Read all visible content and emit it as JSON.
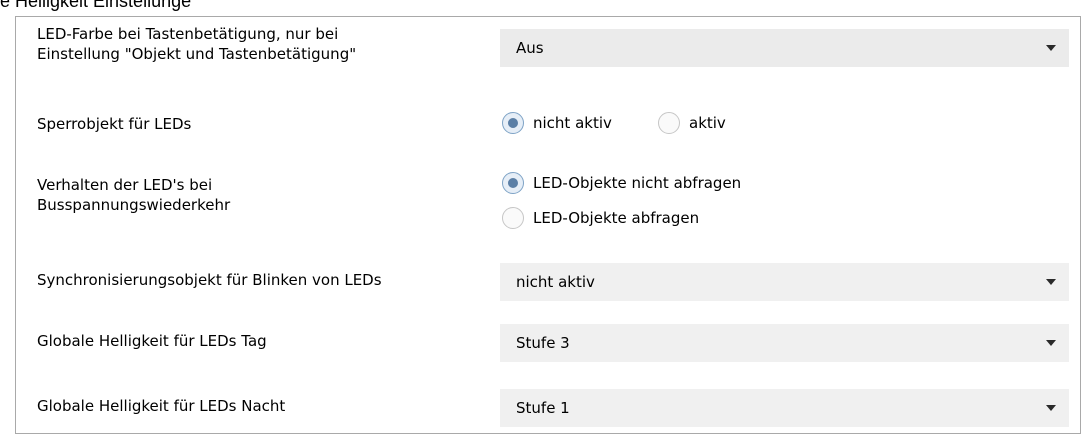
{
  "caption": "e Helligkeit Einstellunge",
  "rows": {
    "led_color": {
      "label_line1": "LED-Farbe bei Tastenbetätigung, nur bei",
      "label_line2": "Einstellung \"Objekt und Tastenbetätigung\"",
      "value": "Aus"
    },
    "lock_object": {
      "label": "Sperrobjekt für LEDs",
      "options": [
        "nicht aktiv",
        "aktiv"
      ],
      "selected": "nicht aktiv"
    },
    "bus_recovery": {
      "label_line1": "Verhalten der LED's  bei",
      "label_line2": "Busspannungswiederkehr",
      "options": [
        "LED-Objekte nicht abfragen",
        "LED-Objekte abfragen"
      ],
      "selected": "LED-Objekte nicht abfragen"
    },
    "sync_object": {
      "label": "Synchronisierungsobjekt für Blinken von LEDs",
      "value": "nicht aktiv"
    },
    "brightness_day": {
      "label": "Globale Helligkeit für LEDs Tag",
      "value": "Stufe 3"
    },
    "brightness_night": {
      "label": "Globale Helligkeit für LEDs Nacht",
      "value": "Stufe 1"
    }
  },
  "colors": {
    "dropdown_bg": "#f0f0f0",
    "radio_checked_dot": "#5b7fa6",
    "panel_border": "#a9a9a9"
  },
  "icons": {
    "dropdown_caret": "caret-down-icon",
    "radio_checked": "radio-checked-icon",
    "radio_unchecked": "radio-unchecked-icon"
  }
}
